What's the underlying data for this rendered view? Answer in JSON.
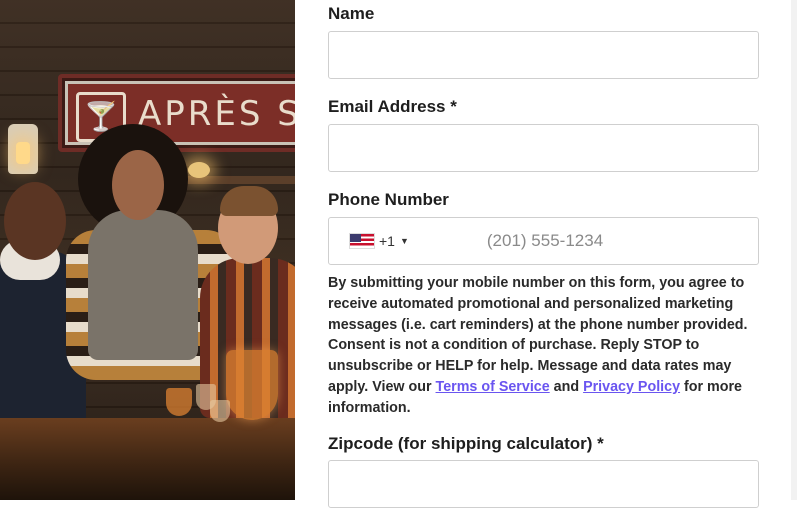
{
  "photo": {
    "sign_text": "APRÈS S",
    "sign_icon": "cocktail-glass-icon",
    "alt": ""
  },
  "form": {
    "name_label": "Name",
    "name_value": "",
    "email_label": "Email Address *",
    "email_value": "",
    "phone_label": "Phone Number",
    "phone": {
      "flag": "us-flag-icon",
      "dial_code": "+1",
      "placeholder": "(201) 555-1234",
      "value": ""
    },
    "consent": {
      "text_before": "By submitting your mobile number on this form, you agree to receive automated promotional and personalized marketing messages (i.e. cart reminders) at the phone number provided. Consent is not a condition of purchase. Reply STOP to unsubscribe or HELP for help. Message and data rates may apply. View our ",
      "terms_link": "Terms of Service",
      "and_text": " and ",
      "privacy_link": "Privacy Policy",
      "text_after": " for more information.",
      "link_color": "#6a55f0"
    },
    "zip_label": "Zipcode (for shipping calculator) *",
    "zip_value": ""
  }
}
